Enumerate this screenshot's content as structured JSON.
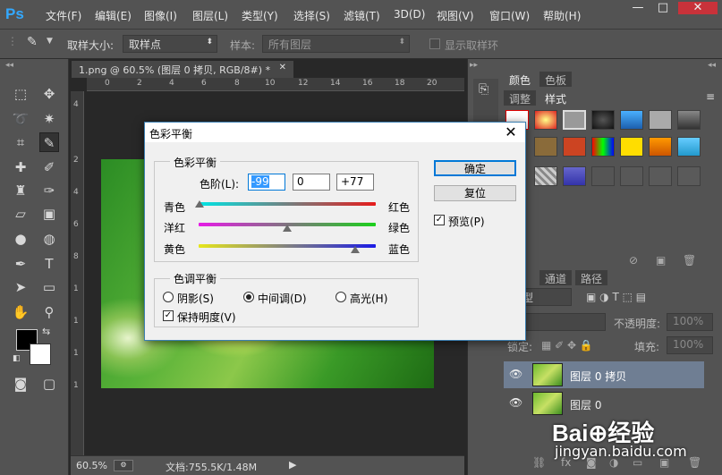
{
  "app": {
    "logo": "Ps"
  },
  "menu": [
    "文件(F)",
    "编辑(E)",
    "图像(I)",
    "图层(L)",
    "类型(Y)",
    "选择(S)",
    "滤镜(T)",
    "3D(D)",
    "视图(V)",
    "窗口(W)",
    "帮助(H)"
  ],
  "window_controls": {
    "min": "—",
    "max": "□",
    "close": "✕"
  },
  "options": {
    "sample_size_label": "取样大小:",
    "sample_size_value": "取样点",
    "sample_label": "样本:",
    "sample_value": "所有图层",
    "show_ring_label": "显示取样环"
  },
  "document": {
    "tab_title": "1.png @ 60.5% (图层 0 拷贝, RGB/8#) *",
    "tab_close": "✕",
    "zoom": "60.5%",
    "doc_info": "文档:755.5K/1.48M"
  },
  "ruler": {
    "top": [
      "0",
      "2",
      "4",
      "6",
      "8",
      "10",
      "12",
      "14",
      "16",
      "18",
      "20"
    ],
    "left": [
      "4",
      "2",
      "4",
      "6",
      "8",
      "1",
      "1",
      "1",
      "1"
    ]
  },
  "panels": {
    "top_tabs": [
      "颜色",
      "色板"
    ],
    "mid_tabs": [
      "调整",
      "样式"
    ],
    "layers_tabs": [
      "层",
      "通道",
      "路径"
    ],
    "kind_label": "类型",
    "blend_value": "常",
    "opacity_label": "不透明度:",
    "opacity_value": "100%",
    "lock_label": "锁定:",
    "fill_label": "填充:",
    "fill_value": "100%",
    "layers": [
      {
        "name": "图层 0 拷贝"
      },
      {
        "name": "图层 0"
      }
    ]
  },
  "dialog": {
    "title": "色彩平衡",
    "color_balance_group": "色彩平衡",
    "levels_label": "色阶(L):",
    "levels": [
      "-99",
      "0",
      "+77"
    ],
    "sliders": [
      {
        "left": "青色",
        "right": "红色",
        "value": -99
      },
      {
        "left": "洋红",
        "right": "绿色",
        "value": 0
      },
      {
        "left": "黄色",
        "right": "蓝色",
        "value": 77
      }
    ],
    "tone_group": "色调平衡",
    "tones": [
      "阴影(S)",
      "中间调(D)",
      "高光(H)"
    ],
    "selected_tone": "中间调(D)",
    "preserve_label": "保持明度(V)",
    "preserve_checked": true,
    "ok": "确定",
    "reset": "复位",
    "preview_label": "预览(P)",
    "preview_checked": true
  },
  "watermark": {
    "brand": "Bai⊕经验",
    "url": "jingyan.baidu.com"
  }
}
